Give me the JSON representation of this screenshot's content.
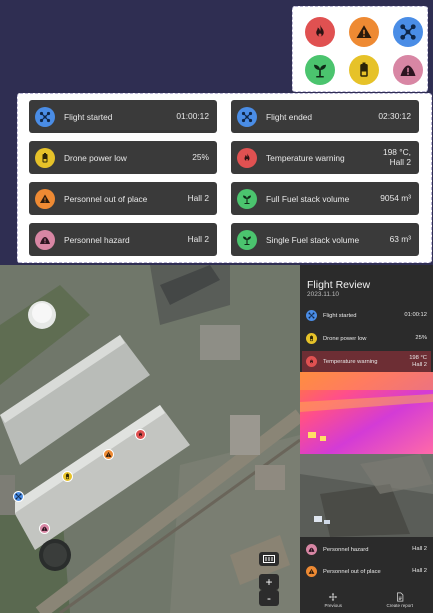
{
  "colors": {
    "blue": "#4a8de6",
    "yellow": "#e6c229",
    "red": "#e05151",
    "orange": "#ee8a33",
    "green": "#4bc46e",
    "pink": "#d886a4",
    "tile_bg": "#3a3a3a",
    "panel_bg": "#2b2b2b",
    "active_row": "#6d2e34"
  },
  "legend_icons": [
    {
      "name": "fire-icon",
      "color": "red"
    },
    {
      "name": "warning-icon",
      "color": "orange"
    },
    {
      "name": "drone-icon",
      "color": "blue"
    },
    {
      "name": "plant-icon",
      "color": "green"
    },
    {
      "name": "battery-icon",
      "color": "yellow"
    },
    {
      "name": "hazard-pile-icon",
      "color": "pink"
    }
  ],
  "tiles": {
    "flight_started": {
      "label": "Flight started",
      "value": "01:00:12"
    },
    "flight_ended": {
      "label": "Flight ended",
      "value": "02:30:12"
    },
    "drone_power_low": {
      "label": "Drone power low",
      "value": "25%"
    },
    "temperature_warning": {
      "label": "Temperature warning",
      "value_line1": "198 °C,",
      "value_line2": "Hall 2"
    },
    "personnel_out_of_place": {
      "label": "Personnel out of place",
      "value": "Hall 2"
    },
    "full_fuel_stack": {
      "label": "Full Fuel stack volume",
      "value": "9054 m³"
    },
    "personnel_hazard": {
      "label": "Personnel hazard",
      "value": "Hall 2"
    },
    "single_fuel_stack": {
      "label": "Single Fuel stack volume",
      "value": "63 m³"
    }
  },
  "map": {
    "zoom_in": "+",
    "zoom_out": "-"
  },
  "review": {
    "title": "Flight Review",
    "date": "2023.11.10",
    "rows": {
      "flight_started": {
        "label": "Flight started",
        "value": "01:00:12"
      },
      "drone_power_low": {
        "label": "Drone power low",
        "value": "25%"
      },
      "temperature_warning": {
        "label": "Temperature warning",
        "value_line1": "198 °C",
        "value_line2": "Hall 2"
      },
      "personnel_hazard": {
        "label": "Personnel hazard",
        "value": "Hall 2"
      },
      "personnel_out_of_place": {
        "label": "Personnel out of place",
        "value": "Hall 2"
      }
    },
    "actions": {
      "previous": "Previous",
      "create_report": "Create report"
    }
  }
}
